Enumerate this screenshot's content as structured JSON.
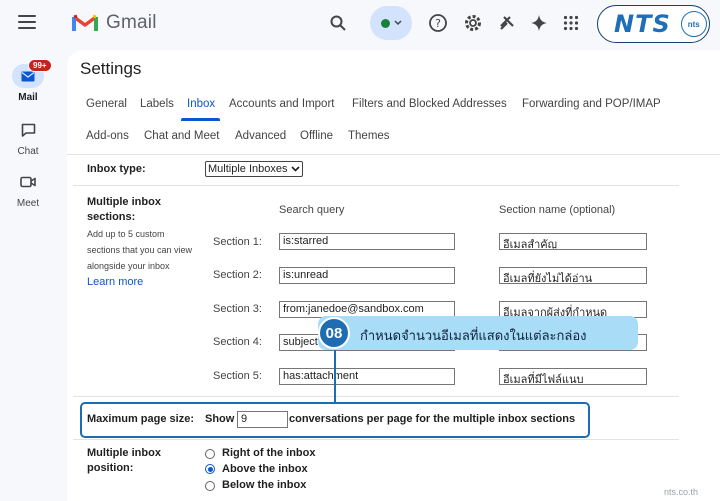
{
  "header": {
    "app_name": "Gmail",
    "brand_logo": "NTS",
    "brand_badge": "nts"
  },
  "rail": {
    "mail_label": "Mail",
    "mail_badge": "99+",
    "chat_label": "Chat",
    "meet_label": "Meet"
  },
  "settings": {
    "title": "Settings",
    "tabs_row1": [
      "General",
      "Labels",
      "Inbox",
      "Accounts and Import",
      "Filters and Blocked Addresses",
      "Forwarding and POP/IMAP"
    ],
    "tabs_row2": [
      "Add-ons",
      "Chat and Meet",
      "Advanced",
      "Offline",
      "Themes"
    ],
    "active_tab": "Inbox",
    "inbox_type_label": "Inbox type:",
    "inbox_type_value": "Multiple Inboxes",
    "multi_label": "Multiple inbox sections:",
    "multi_desc": [
      "Add up to 5 custom",
      "sections that you can view",
      "alongside your inbox"
    ],
    "learn_more": "Learn more",
    "search_query_header": "Search query",
    "section_name_header": "Section name (optional)",
    "sections": [
      {
        "label": "Section 1:",
        "query": "is:starred",
        "name": "อีเมลสำคัญ"
      },
      {
        "label": "Section 2:",
        "query": "is:unread",
        "name": "อีเมลที่ยังไม่ได้อ่าน"
      },
      {
        "label": "Section 3:",
        "query": "from:janedoe@sandbox.com",
        "name": "อีเมลจากผู้ส่งที่กำหนด"
      },
      {
        "label": "Section 4:",
        "query": "subject:",
        "name": ""
      },
      {
        "label": "Section 5:",
        "query": "has:attachment",
        "name": "อีเมลที่มีไฟล์แนบ"
      }
    ],
    "max_page_label": "Maximum page size:",
    "show_label": "Show",
    "page_size_value": "9",
    "conversations_label": "conversations per page for the multiple inbox sections",
    "position_label": "Multiple inbox position:",
    "positions": [
      "Right of the inbox",
      "Above the inbox",
      "Below the inbox"
    ],
    "selected_position": "Above the inbox"
  },
  "callout": {
    "step": "08",
    "text": "กำหนดจำนวนอีเมลที่แสดงในแต่ละกล่อง"
  },
  "watermark": "nts.co.th",
  "colors": {
    "accent": "#0b57d0",
    "callout_bg": "#a9dcf6",
    "callout_border": "#1e6db3"
  }
}
